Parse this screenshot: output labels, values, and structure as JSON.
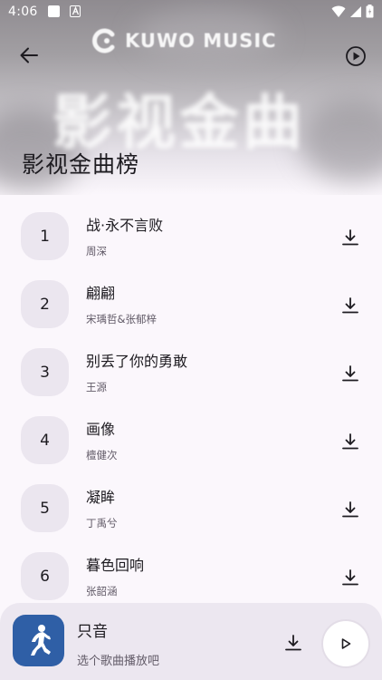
{
  "status_bar": {
    "time": "4:06"
  },
  "header": {
    "brand": "KUWO MUSIC",
    "banner_text": "影视金曲",
    "title": "影视金曲榜"
  },
  "songs": [
    {
      "rank": "1",
      "title": "战·永不言败",
      "artist": "周深"
    },
    {
      "rank": "2",
      "title": "翩翩",
      "artist": "宋瑀哲&张郁梓"
    },
    {
      "rank": "3",
      "title": "别丢了你的勇敢",
      "artist": "王源"
    },
    {
      "rank": "4",
      "title": "画像",
      "artist": "檀健次"
    },
    {
      "rank": "5",
      "title": "凝眸",
      "artist": "丁禹兮"
    },
    {
      "rank": "6",
      "title": "暮色回响",
      "artist": "张韶涵"
    }
  ],
  "player": {
    "title": "只音",
    "subtitle": "选个歌曲播放吧"
  },
  "colors": {
    "background": "#fbf7fc",
    "badge": "#ebe6ef",
    "player_bar": "#ece7f0",
    "cover": "#2f5fa6",
    "text_primary": "#1d1b20",
    "text_secondary": "#625b68"
  },
  "icons": {
    "back": "arrow-left-icon",
    "play": "play-circle-icon",
    "download": "download-icon",
    "status": [
      "wifi-icon",
      "signal-icon",
      "battery-icon"
    ]
  }
}
